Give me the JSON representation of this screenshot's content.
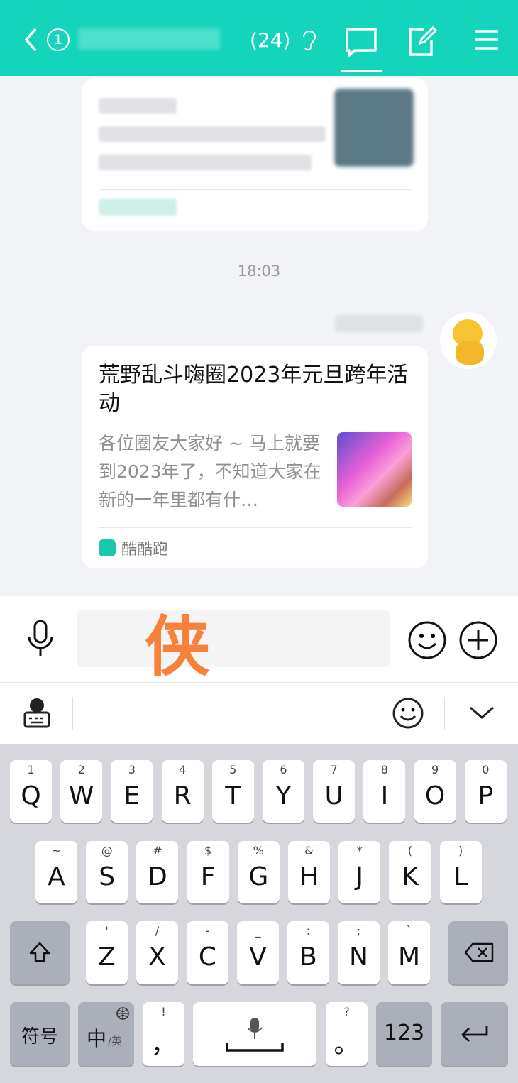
{
  "header": {
    "unread": "1",
    "member_count": "(24)",
    "colors": {
      "bg": "#14d4bc"
    }
  },
  "chat": {
    "timestamp": "18:03",
    "card": {
      "title": "荒野乱斗嗨圈2023年元旦跨年活动",
      "summary": "各位圈友大家好 ~ 马上就要到2023年了，不知道大家在新的一年里都有什…",
      "source": "酷酷跑"
    }
  },
  "input": {
    "typed_char": "侠",
    "typed_color": "#f5813a"
  },
  "keyboard": {
    "row1": [
      [
        "1",
        "Q"
      ],
      [
        "2",
        "W"
      ],
      [
        "3",
        "E"
      ],
      [
        "4",
        "R"
      ],
      [
        "5",
        "T"
      ],
      [
        "6",
        "Y"
      ],
      [
        "7",
        "U"
      ],
      [
        "8",
        "I"
      ],
      [
        "9",
        "O"
      ],
      [
        "0",
        "P"
      ]
    ],
    "row2": [
      [
        "~",
        "A"
      ],
      [
        "@",
        "S"
      ],
      [
        "#",
        "D"
      ],
      [
        "$",
        "F"
      ],
      [
        "%",
        "G"
      ],
      [
        "&",
        "H"
      ],
      [
        "*",
        "J"
      ],
      [
        "(",
        "K"
      ],
      [
        ")",
        "L"
      ]
    ],
    "row3": [
      [
        "'",
        "Z"
      ],
      [
        "/",
        "X"
      ],
      [
        "-",
        "C"
      ],
      [
        "_",
        "V"
      ],
      [
        ":",
        "B"
      ],
      [
        ";",
        "N"
      ],
      [
        "`",
        "M"
      ]
    ],
    "symbols": "符号",
    "lang_main": "中",
    "lang_sub": "/英",
    "comma_hint": "!",
    "comma": "，",
    "period_hint": "?",
    "period": "。",
    "numbers": "123"
  }
}
